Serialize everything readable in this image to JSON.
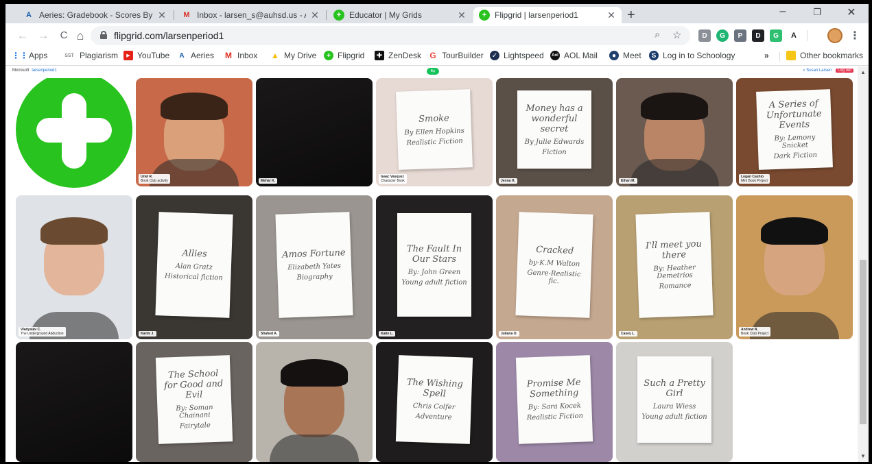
{
  "tabs": [
    {
      "title": "Aeries: Gradebook - Scores By As",
      "icon": "aeries-icon",
      "active": false
    },
    {
      "title": "Inbox - larsen_s@auhsd.us - Ana",
      "icon": "gmail-icon",
      "active": false
    },
    {
      "title": "Educator | My Grids",
      "icon": "flipgrid-icon",
      "active": false
    },
    {
      "title": "Flipgrid | larsenperiod1",
      "icon": "flipgrid-icon",
      "active": true
    }
  ],
  "toolbar": {
    "url": "flipgrid.com/larsenperiod1",
    "back": "←",
    "forward": "→",
    "reload": "C",
    "home": "⌂",
    "extensions": [
      "D",
      "G",
      "P",
      "D",
      "G",
      "A"
    ]
  },
  "bookmarks": [
    {
      "label": "Apps",
      "icon": "apps-icon"
    },
    {
      "label": "Plagiarism",
      "icon": "sst-icon"
    },
    {
      "label": "YouTube",
      "icon": "youtube-icon"
    },
    {
      "label": "Aeries",
      "icon": "aeries-icon"
    },
    {
      "label": "Inbox",
      "icon": "gmail-icon"
    },
    {
      "label": "My Drive",
      "icon": "drive-icon"
    },
    {
      "label": "Flipgrid",
      "icon": "flipgrid-icon"
    },
    {
      "label": "ZenDesk",
      "icon": "zendesk-icon"
    },
    {
      "label": "TourBuilder",
      "icon": "google-icon"
    },
    {
      "label": "Lightspeed",
      "icon": "lightspeed-icon"
    },
    {
      "label": "AOL Mail",
      "icon": "aol-icon"
    },
    {
      "label": "Meet",
      "icon": "meet-icon"
    },
    {
      "label": "Log in to Schoology",
      "icon": "schoology-icon"
    }
  ],
  "bookmarks_overflow": "»",
  "other_bookmarks": "Other bookmarks",
  "flipgrid_bar": {
    "brand": "Microsoft",
    "grid_name": "larsenperiod1",
    "user": "Susan Larsen",
    "logout": "Log out"
  },
  "tiles": [
    {
      "type": "add"
    },
    {
      "type": "person",
      "name": "Uriel R.",
      "topic": "Book Club activity",
      "bg": "#c86a4a",
      "skin": "#d9a07a",
      "hairc": "#3a2418"
    },
    {
      "type": "dark",
      "name": "Mehar K.",
      "topic": ""
    },
    {
      "type": "book",
      "name": "Isaac Vasquez",
      "topic": "Character Book",
      "bg": "#e7d9d3",
      "lines": [
        "Smoke",
        "By Ellen Hopkins",
        "Realistic Fiction"
      ]
    },
    {
      "type": "book",
      "name": "Jenna H.",
      "topic": "",
      "bg": "#5a5048",
      "lines": [
        "Money has a wonderful secret",
        "By Julie Edwards",
        "Fiction"
      ]
    },
    {
      "type": "person",
      "name": "Ethan M.",
      "topic": "",
      "bg": "#6a5a50",
      "skin": "#b98566",
      "hairc": "#1a1412"
    },
    {
      "type": "book",
      "name": "Logan Cashio",
      "topic": "Mini Book Project",
      "bg": "#7a4a30",
      "lines": [
        "A Series of Unfortunate Events",
        "By: Lemony Snicket",
        "Dark Fiction"
      ]
    },
    {
      "type": "person",
      "name": "Vladyslav C.",
      "topic": "The Underground Abduction",
      "bg": "#dfe2e6",
      "skin": "#e3b59a",
      "hairc": "#6a4a30"
    },
    {
      "type": "book",
      "name": "Karim J.",
      "topic": "",
      "bg": "#3a3632",
      "lines": [
        "Allies",
        "Alan Gratz",
        "Historical fiction"
      ]
    },
    {
      "type": "book",
      "name": "Shahed A.",
      "topic": "",
      "bg": "#9a9590",
      "lines": [
        "Amos Fortune",
        "Elizabeth Yates",
        "Biography"
      ]
    },
    {
      "type": "book",
      "name": "Katie L.",
      "topic": "",
      "bg": "#222020",
      "lines": [
        "The Fault In Our Stars",
        "By: John Green",
        "Young adult fiction"
      ]
    },
    {
      "type": "book",
      "name": "Juliana O.",
      "topic": "",
      "bg": "#c5a890",
      "lines": [
        "Cracked",
        "by-K.M Walton",
        "Genre-Realistic fic."
      ]
    },
    {
      "type": "book",
      "name": "Casey L.",
      "topic": "",
      "bg": "#b8a072",
      "lines": [
        "I'll meet you there",
        "By: Heather Demetrios",
        "Romance"
      ]
    },
    {
      "type": "person",
      "name": "Andrew N.",
      "topic": "Book Club Project",
      "bg": "#c99a5a",
      "skin": "#d6a57f",
      "hairc": "#111111"
    },
    {
      "type": "dark",
      "name": "",
      "topic": ""
    },
    {
      "type": "book",
      "name": "",
      "topic": "",
      "bg": "#6a6460",
      "lines": [
        "The School for Good and Evil",
        "By: Soman Chainani",
        "Fairytale"
      ]
    },
    {
      "type": "person",
      "name": "",
      "topic": "",
      "bg": "#b9b4ab",
      "skin": "#a87656",
      "hairc": "#151110"
    },
    {
      "type": "book",
      "name": "",
      "topic": "",
      "bg": "#1e1c1c",
      "lines": [
        "The Wishing Spell",
        "Chris Colfer",
        "Adventure"
      ]
    },
    {
      "type": "book",
      "name": "",
      "topic": "",
      "bg": "#9d88a8",
      "lines": [
        "Promise Me Something",
        "By: Sara Kocek",
        "Realistic Fiction"
      ]
    },
    {
      "type": "book",
      "name": "",
      "topic": "",
      "bg": "#d2d0cc",
      "lines": [
        "Such a Pretty Girl",
        "Laura Wiess",
        "Young adult fiction"
      ]
    }
  ]
}
